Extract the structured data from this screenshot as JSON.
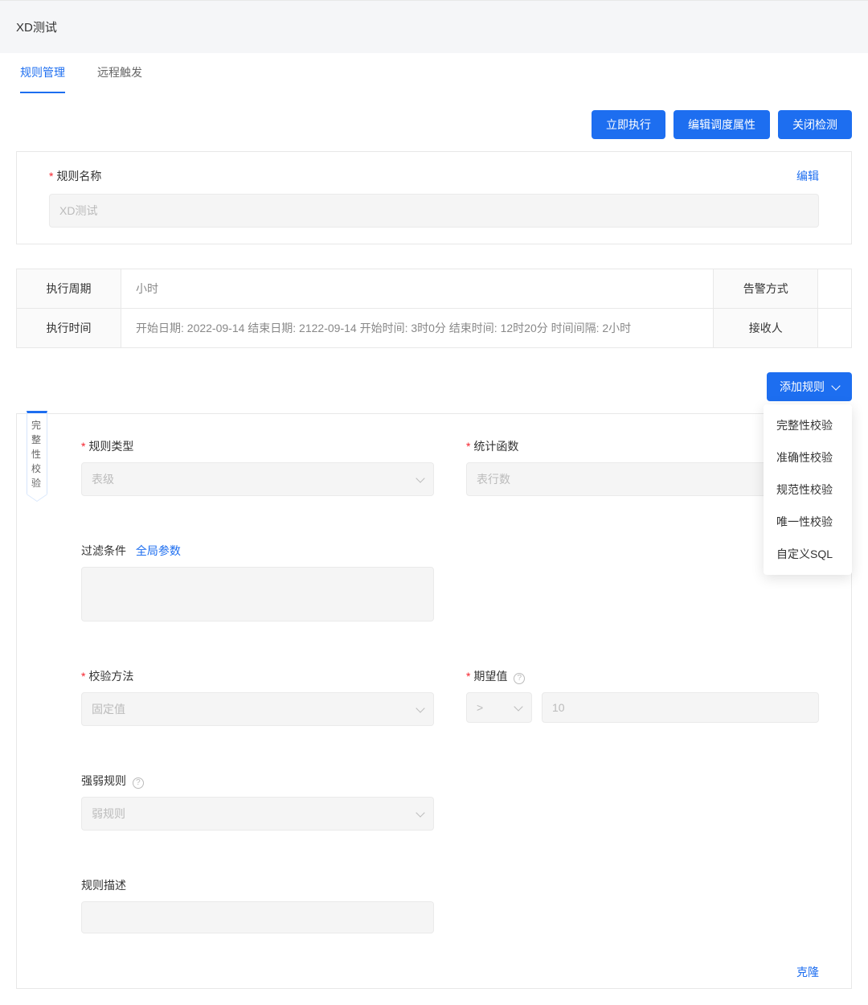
{
  "header": {
    "title": "XD测试"
  },
  "tabs": [
    {
      "label": "规则管理",
      "active": true
    },
    {
      "label": "远程触发",
      "active": false
    }
  ],
  "buttons": {
    "execute_now": "立即执行",
    "edit_schedule": "编辑调度属性",
    "close_detection": "关闭检测"
  },
  "rule_name_panel": {
    "label": "规则名称",
    "value": "XD测试",
    "edit_link": "编辑"
  },
  "info_table": {
    "exec_period_label": "执行周期",
    "exec_period_value": "小时",
    "alarm_method_label": "告警方式",
    "alarm_method_value": "",
    "exec_time_label": "执行时间",
    "exec_time_value": "开始日期: 2022-09-14 结束日期: 2122-09-14 开始时间: 3时0分 结束时间: 12时20分 时间间隔: 2小时",
    "receiver_label": "接收人",
    "receiver_value": ""
  },
  "add_rule": {
    "label": "添加规则",
    "menu": [
      "完整性校验",
      "准确性校验",
      "规范性校验",
      "唯一性校验",
      "自定义SQL"
    ]
  },
  "rule_card": {
    "ribbon": "完整性校验",
    "rule_type_label": "规则类型",
    "rule_type_value": "表级",
    "stat_func_label": "统计函数",
    "stat_func_value": "表行数",
    "filter_label": "过滤条件",
    "global_params_link": "全局参数",
    "check_method_label": "校验方法",
    "check_method_value": "固定值",
    "expected_label": "期望值",
    "expected_op": ">",
    "expected_value": "10",
    "strength_label": "强弱规则",
    "strength_value": "弱规则",
    "desc_label": "规则描述",
    "clone_link": "克隆"
  }
}
